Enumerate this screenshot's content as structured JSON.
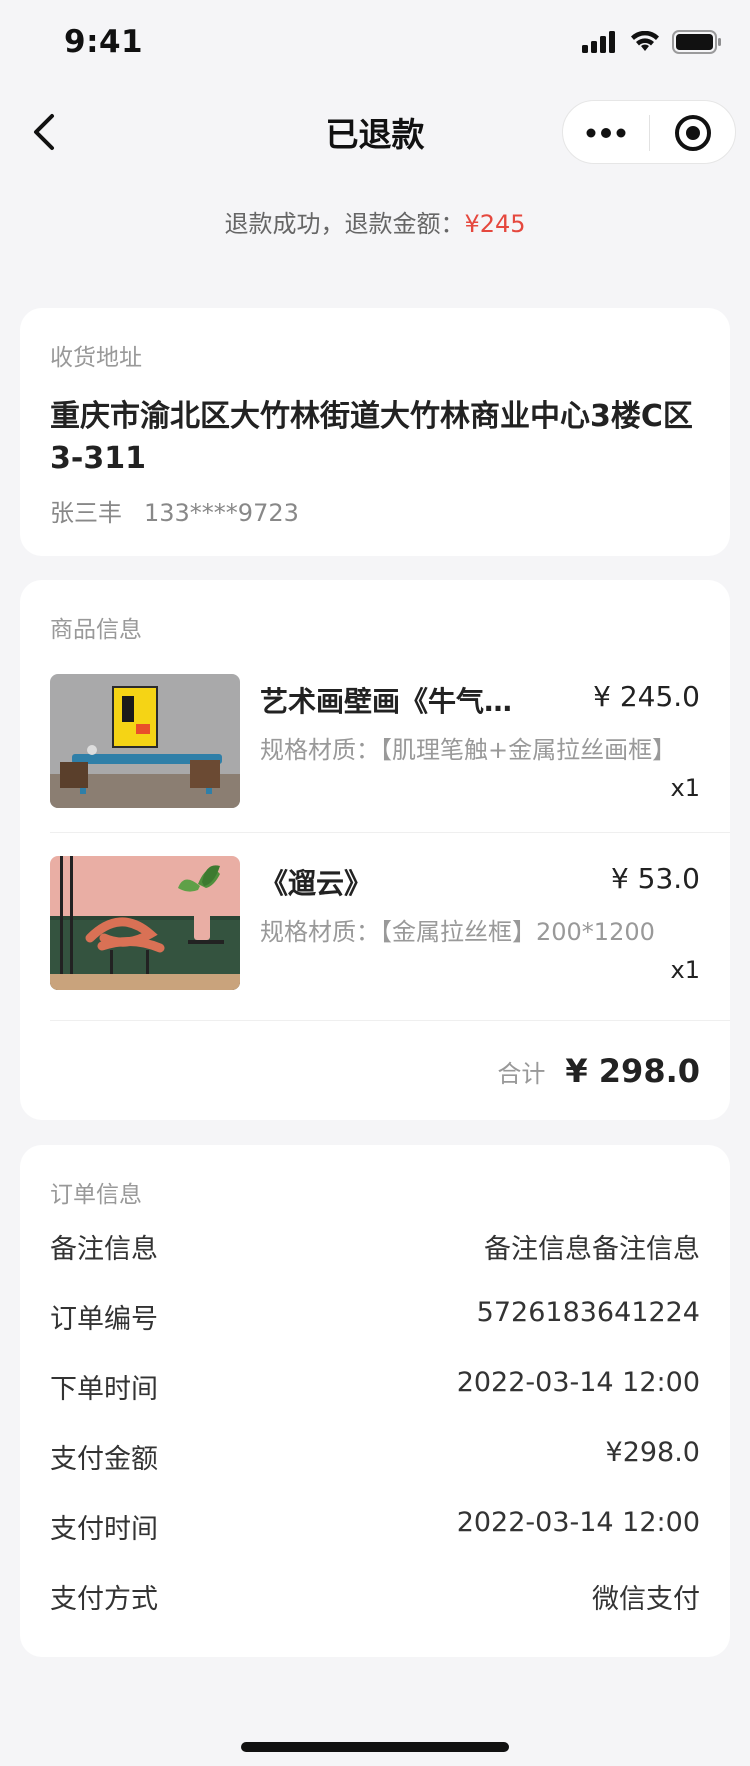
{
  "status_bar": {
    "time": "9:41"
  },
  "nav": {
    "title": "已退款"
  },
  "refund": {
    "prefix": "退款成功，退款金额：",
    "amount": "¥245"
  },
  "address": {
    "section_title": "收货地址",
    "address_text": "重庆市渝北区大竹林街道大竹林商业中心3楼C区3-311",
    "name": "张三丰",
    "phone": "133****9723"
  },
  "goods": {
    "section_title": "商品信息",
    "items": [
      {
        "name": "艺术画壁画《牛气冲天》",
        "price": "¥ 245.0",
        "spec": "规格材质：【肌理笔触+金属拉丝画框】",
        "qty": "x1",
        "image": "artwork-photo"
      },
      {
        "name": "《遛云》",
        "price": "¥ 53.0",
        "spec": "规格材质：【金属拉丝框】200*1200",
        "qty": "x1",
        "image": "interior-photo"
      }
    ],
    "total_label": "合计",
    "total_value": "¥ 298.0"
  },
  "order": {
    "section_title": "订单信息",
    "rows": [
      {
        "label": "备注信息",
        "value": "备注信息备注信息"
      },
      {
        "label": "订单编号",
        "value": "5726183641224"
      },
      {
        "label": "下单时间",
        "value": "2022-03-14 12:00"
      },
      {
        "label": "支付金额",
        "value": "¥298.0"
      },
      {
        "label": "支付时间",
        "value": "2022-03-14 12:00"
      },
      {
        "label": "支付方式",
        "value": "微信支付"
      }
    ]
  },
  "colors": {
    "accent_red": "#e5483e",
    "background": "#f5f5f7",
    "card": "#ffffff"
  }
}
